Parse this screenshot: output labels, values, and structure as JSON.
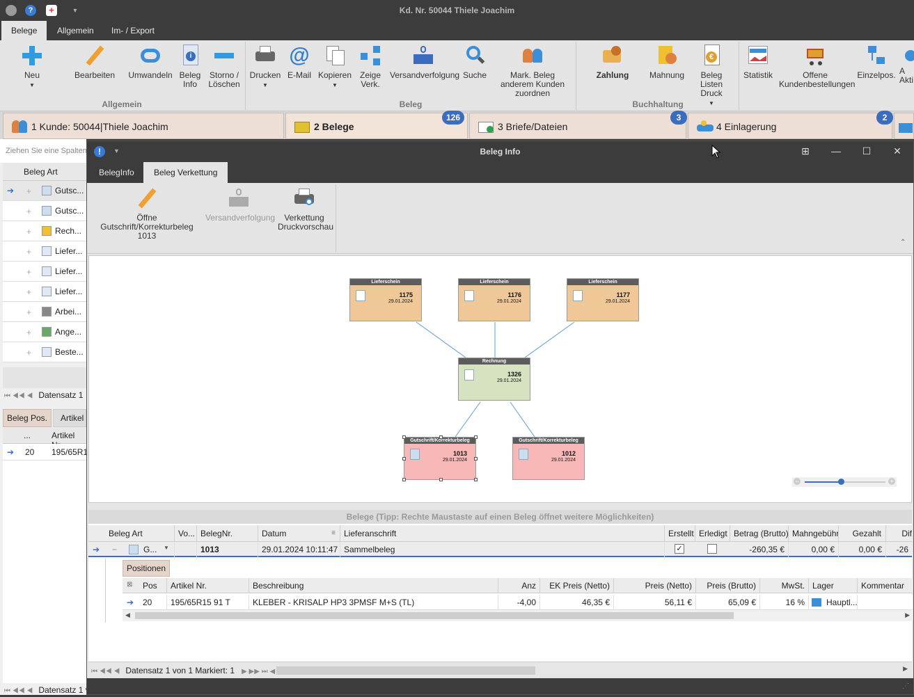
{
  "window": {
    "title": "Kd. Nr. 50044 Thiele Joachim"
  },
  "ribbon_tabs": [
    "Belege",
    "Allgemein",
    "Im- / Export"
  ],
  "ribbon": {
    "buttons": {
      "neu": "Neu",
      "bearbeiten": "Bearbeiten",
      "umwandeln": "Umwandeln",
      "beleg_info": "Beleg Info",
      "storno": "Storno / Löschen",
      "drucken": "Drucken",
      "email": "E-Mail",
      "kopieren": "Kopieren",
      "zeige_verk": "Zeige Verk.",
      "versandverfolgung": "Versandverfolgung",
      "suche": "Suche",
      "mark_beleg": "Mark. Beleg anderem Kunden zuordnen",
      "zahlung": "Zahlung",
      "mahnung": "Mahnung",
      "beleg_listen": "Beleg Listen Druck",
      "statistik": "Statistik",
      "offene": "Offene Kundenbestellungen",
      "einzelpos": "Einzelpos.",
      "akti": "A Akti"
    },
    "groups": {
      "allgemein": "Allgemein",
      "beleg": "Beleg",
      "buchhaltung": "Buchhaltung"
    }
  },
  "doc_tabs": [
    {
      "label": "1 Kunde: 50044|Thiele Joachim"
    },
    {
      "label": "2 Belege",
      "badge": "126"
    },
    {
      "label": "3 Briefe/Dateien",
      "badge": "3"
    },
    {
      "label": "4 Einlagerung",
      "badge": "2"
    }
  ],
  "left": {
    "group_hint": "Ziehen Sie eine Spaltenü",
    "col_header": "Beleg Art",
    "rows": [
      "Gutsc...",
      "Gutsc...",
      "Rech...",
      "Liefer...",
      "Liefer...",
      "Liefer...",
      "Arbei...",
      "Ange...",
      "Beste..."
    ],
    "datensatz": "Datensatz 1",
    "bottom_tabs": [
      "Beleg Pos.",
      "Artikel I"
    ],
    "pos_headers": [
      "...",
      "Artikel Nr."
    ],
    "pos_row": [
      "20",
      "195/65R1"
    ],
    "datensatz2": "Datensatz 1 v"
  },
  "dialog": {
    "title": "Beleg Info",
    "tabs": [
      "BelegInfo",
      "Beleg Verkettung"
    ],
    "ribbon": {
      "oeffne": "Öffne Gutschrift/Korrekturbeleg 1013",
      "versand": "Versandverfolgung",
      "verkettung": "Verkettung Druckvorschau"
    },
    "nodes": [
      {
        "type": "Lieferschein",
        "nr": "1175",
        "date": "29.01.2024"
      },
      {
        "type": "Lieferschein",
        "nr": "1176",
        "date": "29.01.2024"
      },
      {
        "type": "Lieferschein",
        "nr": "1177",
        "date": "29.01.2024"
      },
      {
        "type": "Rechnung",
        "nr": "1326",
        "date": "29.01.2024"
      },
      {
        "type": "Gutschrift/Korrekturbeleg",
        "nr": "1013",
        "date": "29.01.2024"
      },
      {
        "type": "Gutschrift/Korrekturbeleg",
        "nr": "1012",
        "date": "29.01.2024"
      }
    ],
    "zoom": 0.45,
    "grid": {
      "header": "Belege (Tipp: Rechte Maustaste auf einen Beleg öffnet weitere Möglichkeiten)",
      "columns": [
        "Beleg Art",
        "Vo...",
        "BelegNr.",
        "Datum",
        "Lieferanschrift",
        "Erstellt",
        "Erledigt",
        "Betrag (Brutto)",
        "Mahngebühr",
        "Gezahlt",
        "Dif"
      ],
      "row": {
        "art": "G...",
        "vo": "",
        "nr": "1013",
        "datum": "29.01.2024 10:11:47",
        "liefer": "Sammelbeleg",
        "betrag": "-260,35 €",
        "mahn": "0,00 €",
        "gezahlt": "0,00 €",
        "dif": "-26"
      },
      "sub_tab": "Positionen",
      "sub_columns": [
        "Pos",
        "Artikel Nr.",
        "Beschreibung",
        "Anz",
        "EK Preis (Netto)",
        "Preis (Netto)",
        "Preis (Brutto)",
        "MwSt.",
        "Lager",
        "Kommentar"
      ],
      "sub_row": [
        "20",
        "195/65R15 91 T",
        "KLEBER - KRISALP HP3 3PMSF M+S (TL)",
        "-4,00",
        "46,35 €",
        "56,11 €",
        "65,09 €",
        "16 %",
        "Hauptl...",
        ""
      ]
    },
    "status": "Datensatz 1 von 1 Markiert: 1"
  }
}
